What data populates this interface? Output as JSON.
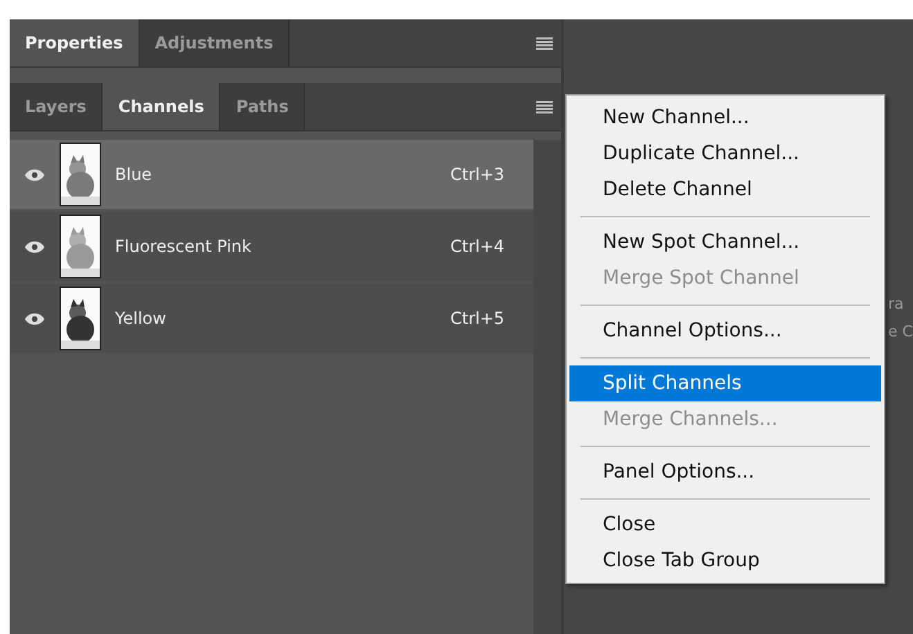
{
  "top_tabs": [
    {
      "label": "Properties",
      "selected": true
    },
    {
      "label": "Adjustments",
      "selected": false
    }
  ],
  "panel_tabs": [
    {
      "label": "Layers",
      "selected": false
    },
    {
      "label": "Channels",
      "selected": true
    },
    {
      "label": "Paths",
      "selected": false
    }
  ],
  "channels": [
    {
      "name": "Blue",
      "shortcut": "Ctrl+3",
      "selected": true,
      "visible": true
    },
    {
      "name": "Fluorescent Pink",
      "shortcut": "Ctrl+4",
      "selected": false,
      "visible": true
    },
    {
      "name": "Yellow",
      "shortcut": "Ctrl+5",
      "selected": false,
      "visible": true
    }
  ],
  "background_text": [
    "ra",
    "e C"
  ],
  "menu": [
    {
      "kind": "item",
      "label": "New Channel...",
      "disabled": false,
      "selected": false
    },
    {
      "kind": "item",
      "label": "Duplicate Channel...",
      "disabled": false,
      "selected": false
    },
    {
      "kind": "item",
      "label": "Delete Channel",
      "disabled": false,
      "selected": false
    },
    {
      "kind": "separator"
    },
    {
      "kind": "item",
      "label": "New Spot Channel...",
      "disabled": false,
      "selected": false
    },
    {
      "kind": "item",
      "label": "Merge Spot Channel",
      "disabled": true,
      "selected": false
    },
    {
      "kind": "separator"
    },
    {
      "kind": "item",
      "label": "Channel Options...",
      "disabled": false,
      "selected": false
    },
    {
      "kind": "separator"
    },
    {
      "kind": "item",
      "label": "Split Channels",
      "disabled": false,
      "selected": true
    },
    {
      "kind": "item",
      "label": "Merge Channels...",
      "disabled": true,
      "selected": false
    },
    {
      "kind": "separator"
    },
    {
      "kind": "item",
      "label": "Panel Options...",
      "disabled": false,
      "selected": false
    },
    {
      "kind": "separator"
    },
    {
      "kind": "item",
      "label": "Close",
      "disabled": false,
      "selected": false
    },
    {
      "kind": "item",
      "label": "Close Tab Group",
      "disabled": false,
      "selected": false
    }
  ]
}
